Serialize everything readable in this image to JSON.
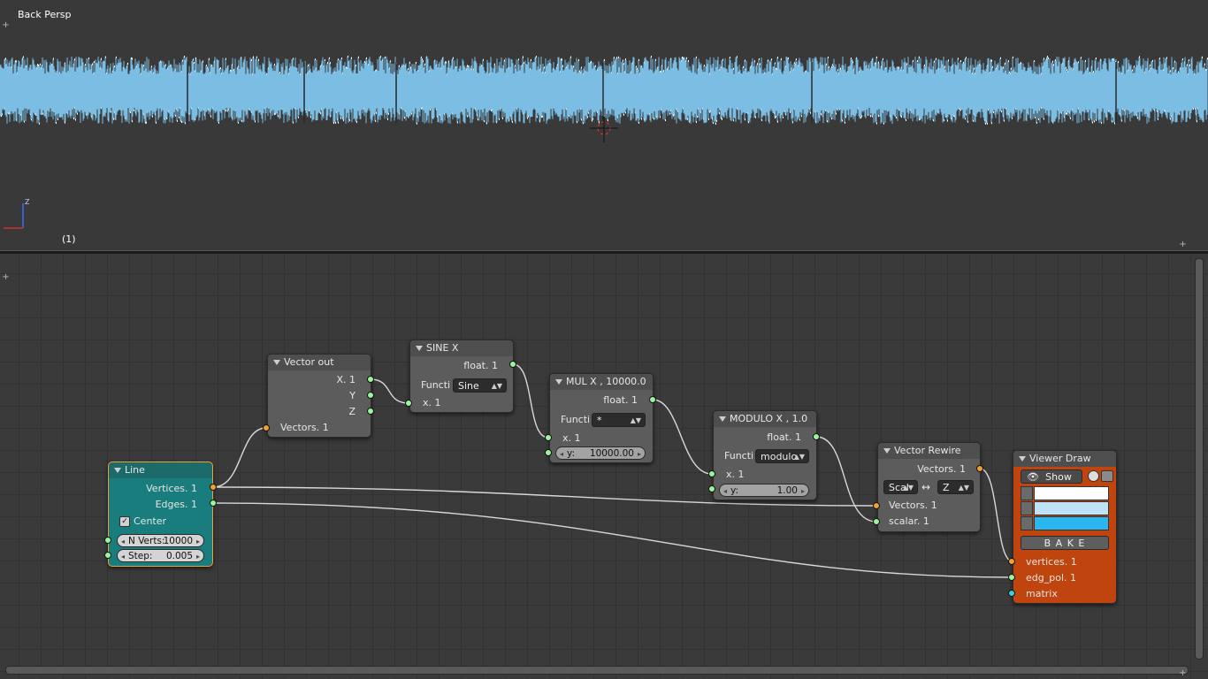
{
  "viewport": {
    "view_label": "Back Persp",
    "frame_label": "(1)",
    "axis_label": "Z",
    "wave_color": "#7cbde4"
  },
  "nodes": {
    "line": {
      "title": "Line",
      "out_vertices": "Vertices. 1",
      "out_edges": "Edges. 1",
      "center_label": "Center",
      "center_checked": true,
      "nverts_label": "N Verts:",
      "nverts_value": "10000",
      "step_label": "Step:",
      "step_value": "0.005",
      "color": "#1a7d7d"
    },
    "vector_out": {
      "title": "Vector out",
      "out_x": "X. 1",
      "out_y": "Y",
      "out_z": "Z",
      "in_vectors": "Vectors. 1"
    },
    "sine": {
      "title": "SINE X",
      "out_float": "float. 1",
      "func_label": "Functi",
      "func_value": "Sine",
      "in_x": "x. 1"
    },
    "mul": {
      "title": "MUL X ,  10000.0",
      "out_float": "float. 1",
      "func_label": "Functi",
      "func_value": "*",
      "in_x": "x. 1",
      "y_label": "y:",
      "y_value": "10000.00"
    },
    "modulo": {
      "title": "MODULO X ,  1.0",
      "out_float": "float. 1",
      "func_label": "Functi",
      "func_value": "modulo",
      "in_x": "x. 1",
      "y_label": "y:",
      "y_value": "1.00"
    },
    "rewire": {
      "title": "Vector Rewire",
      "out_vectors": "Vectors. 1",
      "from_value": "Scal",
      "swap_symbol": "↔",
      "to_value": "Z",
      "in_vectors": "Vectors. 1",
      "in_scalar": "scalar. 1"
    },
    "viewer": {
      "title": "Viewer Draw",
      "show_label": "Show",
      "bake_label": "B A K E",
      "in_vertices": "vertices. 1",
      "in_edges": "edg_pol. 1",
      "in_matrix": "matrix",
      "color": "#c0440e",
      "swatch_colors": [
        "#ffffff",
        "#bfe3f6",
        "#2ab7f0"
      ]
    }
  }
}
